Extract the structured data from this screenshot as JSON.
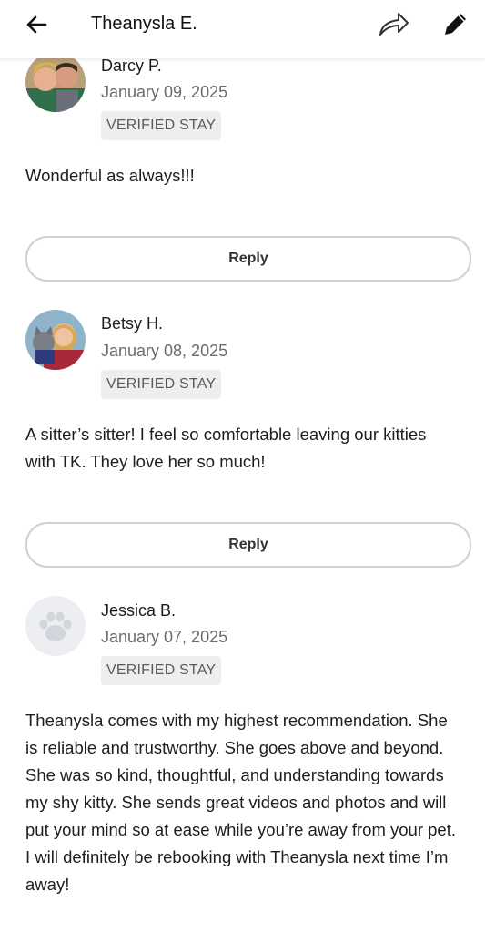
{
  "header": {
    "title": "Theanysla E."
  },
  "reviews": [
    {
      "name": "Darcy P.",
      "date": "January 09, 2025",
      "badge": "VERIFIED STAY",
      "text": "Wonderful as always!!!",
      "reply_label": "Reply"
    },
    {
      "name": "Betsy H.",
      "date": "January 08, 2025",
      "badge": "VERIFIED STAY",
      "text": "A sitter’s sitter! I feel so comfortable leaving our kitties with TK. They love her so much!",
      "reply_label": "Reply"
    },
    {
      "name": "Jessica B.",
      "date": "January 07, 2025",
      "badge": "VERIFIED STAY",
      "text": "Theanysla comes with my highest recommendation. She is reliable and trustworthy. She goes above and beyond. She was so kind, thoughtful, and understanding towards my shy kitty. She sends great videos and photos and will put your mind so at ease while you’re away from your pet. I will definitely be rebooking with Theanysla next time I’m away!"
    }
  ],
  "colors": {
    "badge_bg": "#eeeef0",
    "reply_border": "#d0d0d5",
    "paw": "#d2d6dc"
  },
  "icons": [
    "back-arrow-icon",
    "share-icon",
    "edit-pencil-icon",
    "paw-icon"
  ]
}
